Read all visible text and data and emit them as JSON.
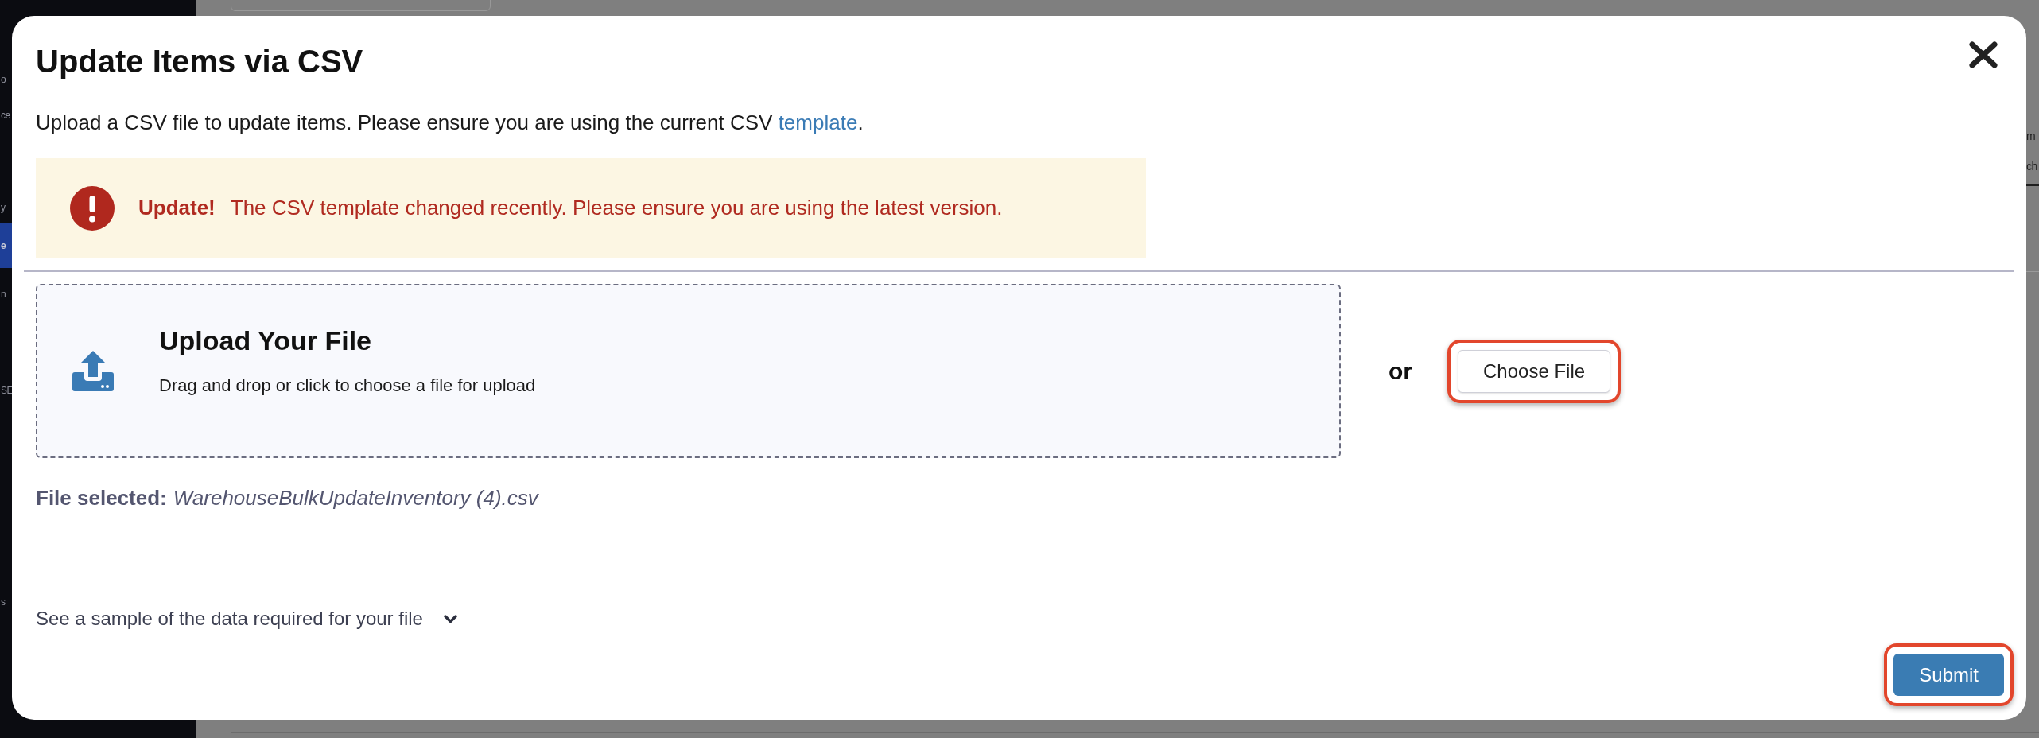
{
  "background": {
    "sidebar_items": [
      {
        "label": "o",
        "selected": false
      },
      {
        "label": "ce",
        "selected": false
      },
      {
        "label": "y",
        "selected": false
      },
      {
        "label": "e",
        "selected": true
      },
      {
        "label": "n",
        "selected": false
      },
      {
        "label": "SE",
        "selected": false
      },
      {
        "label": "s",
        "selected": false
      }
    ],
    "right_text": [
      "m",
      "ch"
    ]
  },
  "dialog": {
    "title": "Update Items via CSV",
    "description": {
      "text": "Upload a CSV file to update items. Please ensure you are using the current CSV",
      "link": "template",
      "after": "."
    },
    "alert": {
      "heading": "Update!",
      "message": "The CSV template changed recently. Please ensure you are using the latest version."
    },
    "dropzone": {
      "title": "Upload Your File",
      "hint": "Drag and drop or click to choose a file for upload"
    },
    "or_label": "or",
    "choose_file_button": {
      "label": "Choose File",
      "highlighted": true
    },
    "file_selected": {
      "label": "File selected:",
      "filename": "WarehouseBulkUpdateInventory (4).csv"
    },
    "sample_toggle": {
      "label": "See a sample of the data required for your file",
      "expanded": false
    },
    "submit_button": {
      "label": "Submit",
      "highlighted": true
    }
  }
}
